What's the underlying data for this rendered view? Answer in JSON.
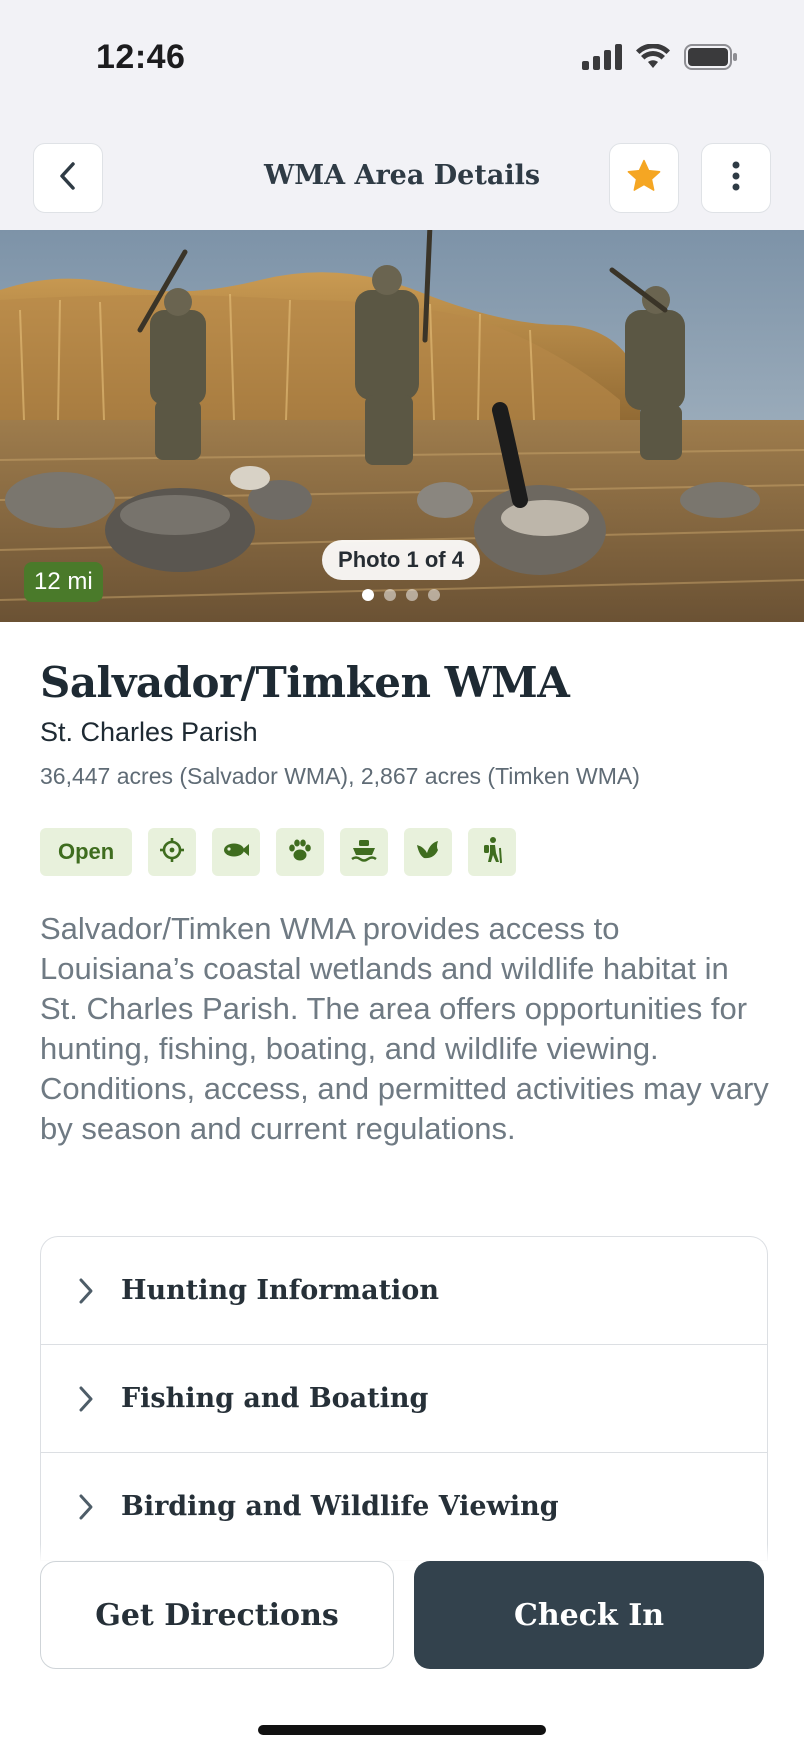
{
  "status_bar": {
    "time": "12:46",
    "icons": [
      "cellular-signal-icon",
      "wifi-icon",
      "battery-icon"
    ]
  },
  "nav": {
    "title": "WMA Area Details",
    "back_icon": "chevron-left-icon",
    "favorite_icon": "star-icon",
    "more_icon": "more-vertical-icon",
    "favorite_color": "#f5a623"
  },
  "hero": {
    "distance": "12 mi",
    "photo_counter": "Photo 1 of 4",
    "photo_index": 1,
    "photo_total": 4
  },
  "area": {
    "name": "Salvador/Timken WMA",
    "parish": "St. Charles Parish",
    "acres": "36,447 acres (Salvador WMA), 2,867 acres (Timken WMA)",
    "status": "Open",
    "activity_icons": [
      "crosshair-icon",
      "fish-icon",
      "paw-icon",
      "boat-icon",
      "bird-icon",
      "hiker-icon"
    ],
    "description": "Salvador/Timken WMA provides access to Louisiana’s coastal wetlands and wildlife habitat in St. Charles Parish. The area offers opportunities for hunting, fishing, boating, and wildlife viewing. Conditions, access, and permitted activities may vary by season and current regulations."
  },
  "sections": [
    {
      "label": "Hunting Information"
    },
    {
      "label": "Fishing and Boating"
    },
    {
      "label": "Birding and Wildlife Viewing"
    }
  ],
  "actions": {
    "directions_label": "Get Directions",
    "checkin_label": "Check In"
  },
  "colors": {
    "primary_dark": "#33424d",
    "accent_green": "#4a7a2a",
    "tag_bg": "#e8f1dc"
  }
}
